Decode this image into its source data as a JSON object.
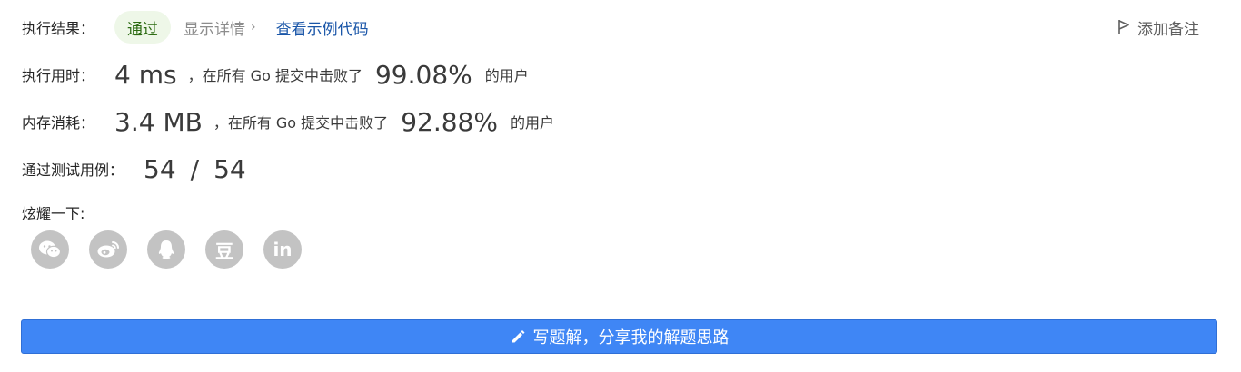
{
  "result": {
    "label": "执行结果：",
    "status": "通过",
    "details_link": "显示详情",
    "sample_code_link": "查看示例代码",
    "add_note": "添加备注"
  },
  "runtime": {
    "label": "执行用时：",
    "value": "4 ms",
    "text": "，在所有 Go 提交中击败了",
    "percent": "99.08%",
    "suffix": "的用户"
  },
  "memory": {
    "label": "内存消耗：",
    "value": "3.4 MB",
    "text": "，在所有 Go 提交中击败了",
    "percent": "92.88%",
    "suffix": "的用户"
  },
  "testcases": {
    "label": "通过测试用例：",
    "passed": "54",
    "separator": "/",
    "total": "54"
  },
  "share": {
    "label": "炫耀一下:",
    "icons": [
      "wechat-icon",
      "weibo-icon",
      "qq-icon",
      "douban-icon",
      "linkedin-icon"
    ],
    "douban_glyph": "豆",
    "linkedin_glyph": "in"
  },
  "solution_button": {
    "label": "写题解，分享我的解题思路"
  },
  "colors": {
    "accent": "#3f86f5",
    "status_bg": "#eef7e8",
    "status_text": "#2c6b12",
    "link": "#1a56a8",
    "icon_bg": "#c3c3c3"
  }
}
